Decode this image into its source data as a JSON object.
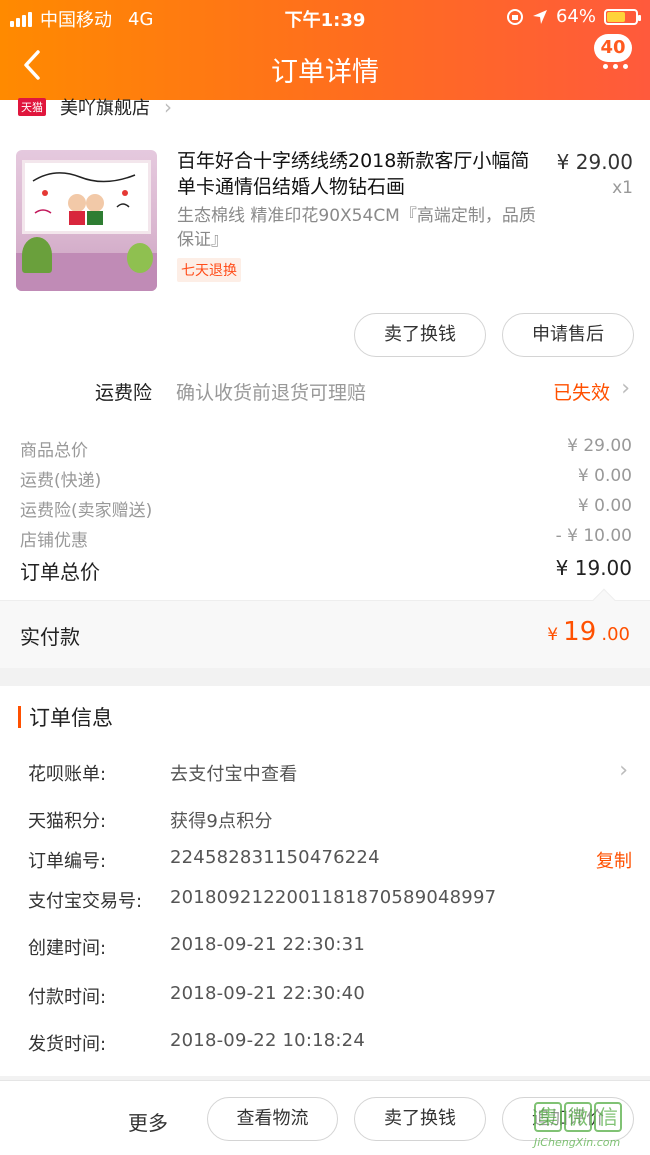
{
  "status_bar": {
    "carrier": "中国移动",
    "network": "4G",
    "time": "下午1:39",
    "battery": "64%",
    "battery_level": 0.64
  },
  "nav": {
    "title": "订单详情",
    "badge": "40"
  },
  "shop": {
    "tag": "天猫",
    "name": "美吖旗舰店"
  },
  "product": {
    "title": "百年好合十字绣线绣2018新款客厅小幅简单卡通情侣结婚人物钻石画",
    "price": "¥ 29.00",
    "quantity": "x1",
    "spec": "生态棉线 精准印花90X54CM『高端定制，品质保证』",
    "tag": "七天退换"
  },
  "product_actions": {
    "sell": "卖了换钱",
    "after_sale": "申请售后"
  },
  "insurance": {
    "label": "运费险",
    "desc": "确认收货前退货可理赔",
    "status": "已失效"
  },
  "costs": [
    {
      "label": "商品总价",
      "value": "¥ 29.00"
    },
    {
      "label": "运费(快递)",
      "value": "¥ 0.00"
    },
    {
      "label": "运费险(卖家赠送)",
      "value": "¥ 0.00"
    },
    {
      "label": "店铺优惠",
      "value": "- ¥ 10.00"
    }
  ],
  "total": {
    "label": "订单总价",
    "value": "¥ 19.00"
  },
  "payment": {
    "label": "实付款",
    "currency": "¥",
    "integer": "19",
    "decimal": ".00"
  },
  "order_info": {
    "title": "订单信息",
    "rows": [
      {
        "key": "花呗账单:",
        "value": "去支付宝中查看"
      },
      {
        "key": "天猫积分:",
        "value": "获得9点积分"
      },
      {
        "key": "订单编号:",
        "value": "224582831150476224",
        "action": "复制"
      },
      {
        "key": "支付宝交易号:",
        "value": "2018092122001181870589048997"
      },
      {
        "key": "创建时间:",
        "value": "2018-09-21 22:30:31"
      },
      {
        "key": "付款时间:",
        "value": "2018-09-21 22:30:40"
      },
      {
        "key": "发货时间:",
        "value": "2018-09-22 10:18:24"
      }
    ]
  },
  "bottom_bar": {
    "more": "更多",
    "logistics": "查看物流",
    "sell": "卖了换钱",
    "review": "追加评价"
  },
  "watermark": {
    "chars": [
      "集",
      "微",
      "信"
    ],
    "url": "JiChengXin.com"
  },
  "colors": {
    "accent": "#ff5000",
    "header_start": "#ff8a00",
    "header_end": "#ff5a3c"
  }
}
